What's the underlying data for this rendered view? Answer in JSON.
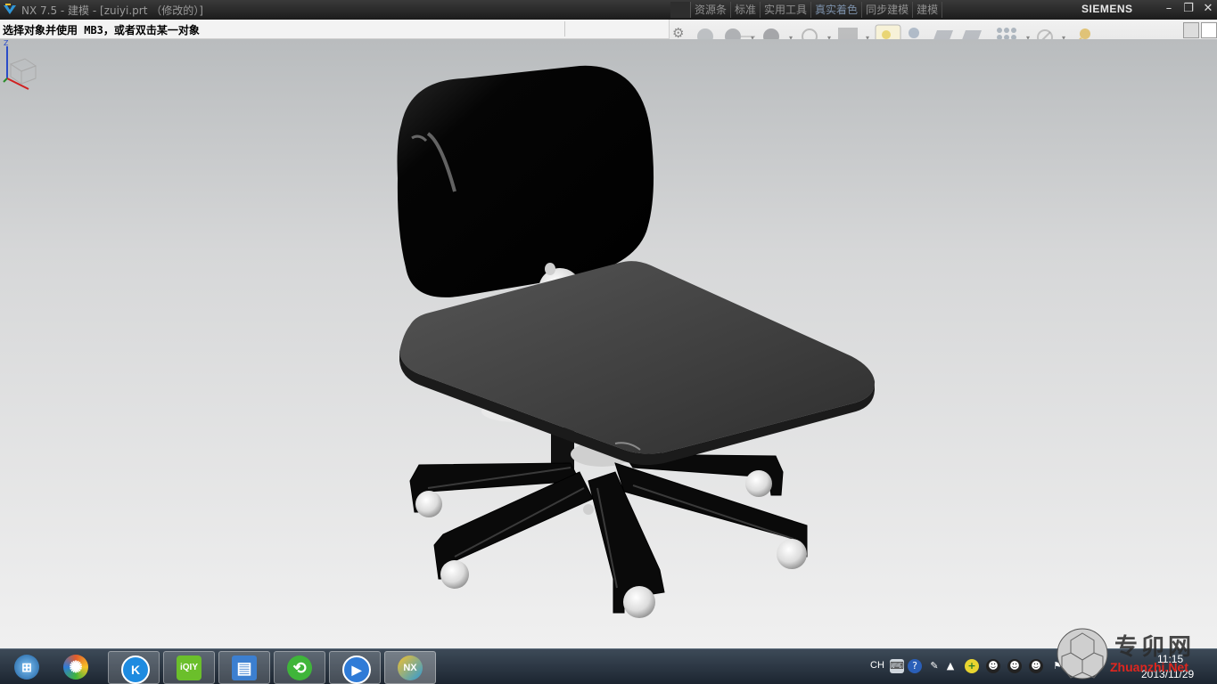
{
  "window": {
    "title": "NX 7.5 - 建模 - [zuiyi.prt （修改的）]",
    "brand": "SIEMENS",
    "menu": [
      "资源条",
      "标准",
      "实用工具",
      "真实着色",
      "同步建模",
      "建模"
    ],
    "controls": [
      "minimize",
      "restore",
      "close"
    ]
  },
  "cue_line": {
    "text": "选择对象并使用 MB3，或者双击某一对象"
  },
  "toolbar": {
    "icons": [
      "settings-gear-icon",
      "shade-sphere-icon",
      "sphere-icon",
      "sphere-dark-icon",
      "no-entry-icon",
      "square-icon",
      "highlight-icon",
      "figure-icon",
      "floor-icon",
      "background-icon",
      "grid-icon",
      "disable-icon",
      "key-icon"
    ]
  },
  "viewport": {
    "model": "office-chair",
    "triad_axis_label": "Z"
  },
  "taskbar": {
    "apps": [
      {
        "name": "start-orb",
        "glyph": "⊞",
        "color": "#3a88c8"
      },
      {
        "name": "app-pinwheel",
        "glyph": "✺",
        "color": "#e25b2b"
      },
      {
        "name": "app-kugou",
        "glyph": "K",
        "color": "#1e8be0"
      },
      {
        "name": "app-iqiyi",
        "glyph": "iQIY",
        "color": "#6bbf2b"
      },
      {
        "name": "app-explorer",
        "glyph": "▤",
        "color": "#3c7fd0"
      },
      {
        "name": "app-green-refresh",
        "glyph": "⟲",
        "color": "#3fb53a"
      },
      {
        "name": "app-media-player",
        "glyph": "▶",
        "color": "#2f7bd7"
      },
      {
        "name": "app-nx",
        "glyph": "NX",
        "color": "#2c9ad8"
      }
    ],
    "tray": {
      "language": "CH",
      "time": "11:15",
      "date": "2013/11/29"
    }
  },
  "watermark": {
    "text": "专卯网",
    "url": "Zhuanzhi.Net"
  }
}
